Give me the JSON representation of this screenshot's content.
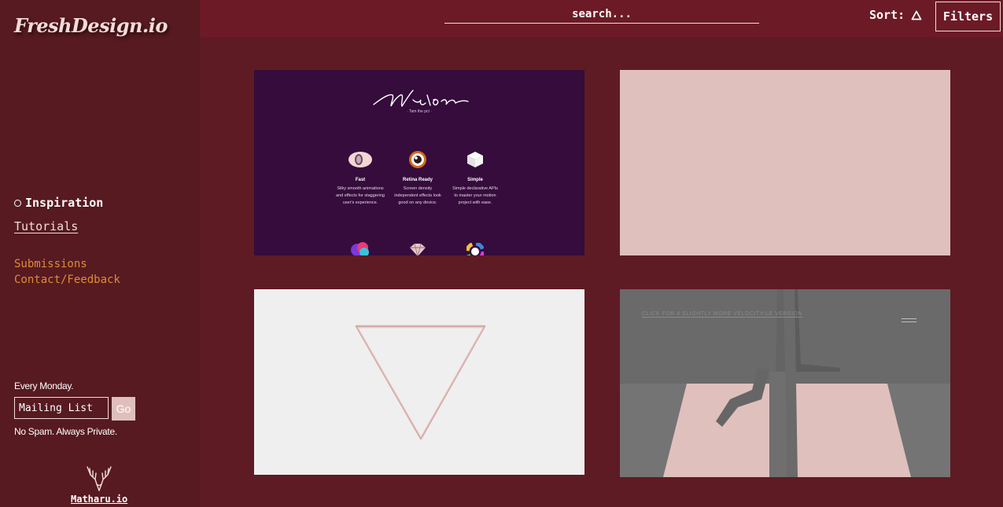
{
  "sidebar": {
    "logo": "FreshDesign.io",
    "nav": {
      "active": "Inspiration",
      "tutorials": "Tutorials"
    },
    "links": [
      "Submissions",
      "Contact/Feedback"
    ],
    "newsletter": {
      "heading": "Every Monday.",
      "input_value": "Mailing List",
      "button": "Go",
      "note": "No Spam. Always Private."
    },
    "credit": "Matharu.io"
  },
  "topbar": {
    "search_placeholder": "search...",
    "sort_label": "Sort:",
    "filters_label": "Filters"
  },
  "cards": {
    "motion": {
      "tagline": "· Tam the pct ·",
      "features": [
        {
          "title": "Fast",
          "desc": "Silky smooth animations and effects for staggering user's experience."
        },
        {
          "title": "Retina Ready",
          "desc": "Screen density independent effects look good on any device."
        },
        {
          "title": "Simple",
          "desc": "Simple declarative APIs to master your motion project with ease."
        }
      ]
    },
    "fourth": {
      "link_text": "CLICK FOR A SLIGHTLY MORE VELOCITY-LE VERSION"
    }
  },
  "colors": {
    "background": "#5f1b23",
    "sidebar": "#561a20",
    "topbar": "#6c1b26",
    "accent_orange": "#e08c36",
    "pink": "#dfc0bd"
  }
}
